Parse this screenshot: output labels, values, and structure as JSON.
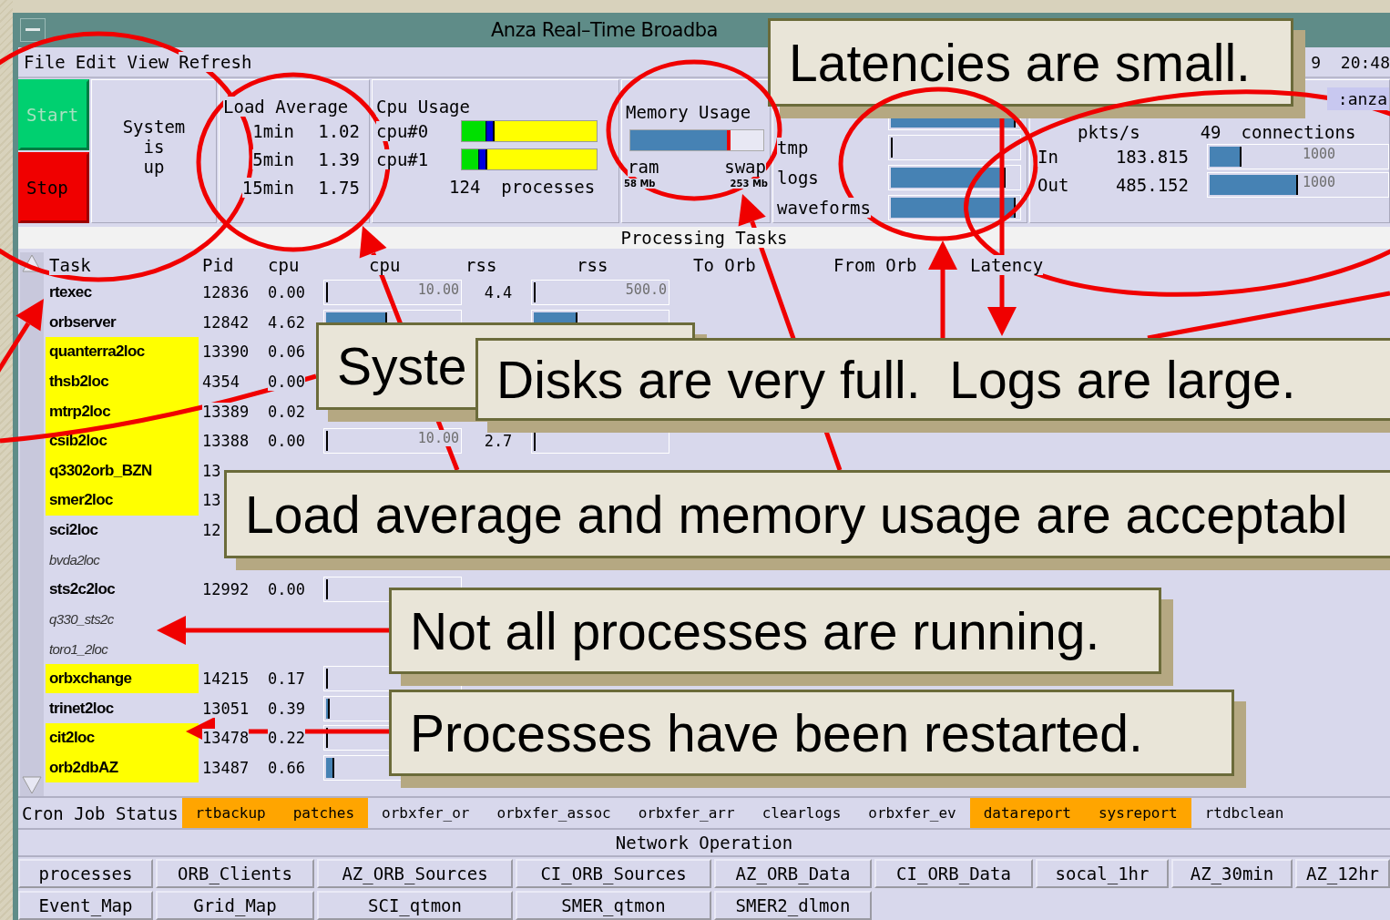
{
  "window": {
    "title": "Anza Real–Time Broadba",
    "clock": "9  20:48"
  },
  "menu": [
    "File",
    "Edit",
    "View",
    "Refresh"
  ],
  "controls": {
    "start": {
      "label": "Start",
      "disabled": true
    },
    "stop": {
      "label": "Stop",
      "disabled": false
    },
    "status": [
      "System",
      "is",
      "up"
    ]
  },
  "load_average": {
    "title": "Load Average",
    "rows": [
      {
        "label": "1min",
        "value": "1.02"
      },
      {
        "label": "5min",
        "value": "1.39"
      },
      {
        "label": "15min",
        "value": "1.75"
      }
    ]
  },
  "cpu_usage": {
    "title": "Cpu Usage",
    "cpus": [
      {
        "label": "cpu#0",
        "level": 0.24
      },
      {
        "label": "cpu#1",
        "level": 0.19
      }
    ],
    "processes": "124",
    "processes_label": "processes"
  },
  "memory": {
    "title": "Memory Usage",
    "level": 0.75,
    "ram_label": "ram",
    "swap_label": "swap",
    "ram_size": "58 Mb",
    "swap_size": "253 Mb"
  },
  "disks": [
    {
      "level": 0.98
    },
    {
      "label": "tmp",
      "level": 0
    },
    {
      "label": "logs",
      "level": 0.9
    },
    {
      "label": "waveforms",
      "level": 0.98
    }
  ],
  "network": {
    "host": ":anza",
    "pkts_label": "pkts/s",
    "connections": "49",
    "connections_label": "connections",
    "links": [
      {
        "label": "In",
        "rate": "183.815",
        "level": 0.18,
        "max": "1000"
      },
      {
        "label": "Out",
        "rate": "485.152",
        "level": 0.5,
        "max": "1000"
      }
    ]
  },
  "processing": {
    "title": "Processing Tasks",
    "columns": [
      "Task",
      "Pid",
      "cpu",
      "cpu",
      "rss",
      "rss",
      "To Orb",
      "From Orb",
      "Latency"
    ],
    "rows": [
      {
        "task": "rtexec",
        "pid": "12836",
        "cpu": "0.00",
        "running": true,
        "restarted": false,
        "cpu_bar": {
          "level": 0,
          "max": "10.00"
        },
        "rss": "4.4",
        "rss_bar": {
          "level": 0,
          "max": "500.0"
        }
      },
      {
        "task": "orbserver",
        "pid": "12842",
        "cpu": "4.62",
        "running": true,
        "restarted": false,
        "cpu_bar": {
          "level": 0.46
        },
        "rss_bar": {
          "level": 0.33
        }
      },
      {
        "task": "quanterra2loc",
        "pid": "13390",
        "cpu": "0.06",
        "running": true,
        "restarted": true
      },
      {
        "task": "thsb2loc",
        "pid": "4354",
        "cpu": "0.00",
        "running": true,
        "restarted": true
      },
      {
        "task": "mtrp2loc",
        "pid": "13389",
        "cpu": "0.02",
        "running": true,
        "restarted": true
      },
      {
        "task": "csib2loc",
        "pid": "13388",
        "cpu": "0.00",
        "running": true,
        "restarted": true,
        "cpu_bar": {
          "level": 0,
          "max": "10.00"
        },
        "rss": "2.7",
        "rss_bar": {
          "level": 0
        }
      },
      {
        "task": "q3302orb_BZN",
        "pid": "13",
        "running": true,
        "restarted": true
      },
      {
        "task": "smer2loc",
        "pid": "13",
        "running": true,
        "restarted": true
      },
      {
        "task": "sci2loc",
        "pid": "12",
        "running": true,
        "restarted": false
      },
      {
        "task": "bvda2loc",
        "running": false,
        "restarted": false
      },
      {
        "task": "sts2c2loc",
        "pid": "12992",
        "cpu": "0.00",
        "running": true,
        "restarted": false,
        "cpu_bar": {
          "level": 0.01
        }
      },
      {
        "task": "q330_sts2c",
        "running": false,
        "restarted": false
      },
      {
        "task": "toro1_2loc",
        "running": false,
        "restarted": false
      },
      {
        "task": "orbxchange",
        "pid": "14215",
        "cpu": "0.17",
        "running": true,
        "restarted": true,
        "cpu_bar": {
          "level": 0.01
        }
      },
      {
        "task": "trinet2loc",
        "pid": "13051",
        "cpu": "0.39",
        "running": true,
        "restarted": false,
        "cpu_bar": {
          "level": 0.03
        }
      },
      {
        "task": "cit2loc",
        "pid": "13478",
        "cpu": "0.22",
        "running": true,
        "restarted": true,
        "cpu_bar": {
          "level": 0.01
        }
      },
      {
        "task": "orb2dbAZ",
        "pid": "13487",
        "cpu": "0.66",
        "running": true,
        "restarted": true,
        "cpu_bar": {
          "level": 0.06
        }
      }
    ]
  },
  "cron": {
    "title": "Cron Job Status",
    "jobs": [
      {
        "name": "rtbackup",
        "flagged": true
      },
      {
        "name": "patches",
        "flagged": true
      },
      {
        "name": "orbxfer_or",
        "flagged": false
      },
      {
        "name": "orbxfer_assoc",
        "flagged": false
      },
      {
        "name": "orbxfer_arr",
        "flagged": false
      },
      {
        "name": "clearlogs",
        "flagged": false
      },
      {
        "name": "orbxfer_ev",
        "flagged": false
      },
      {
        "name": "datareport",
        "flagged": true
      },
      {
        "name": "sysreport",
        "flagged": true
      },
      {
        "name": "rtdbclean",
        "flagged": false
      }
    ]
  },
  "network_operation": {
    "title": "Network Operation",
    "buttons": [
      [
        "processes",
        "ORB_Clients",
        "AZ_ORB_Sources",
        "CI_ORB_Sources",
        "AZ_ORB_Data",
        "CI_ORB_Data",
        "socal_1hr",
        "AZ_30min",
        "AZ_12hr"
      ],
      [
        "Event_Map",
        "Grid_Map",
        "SCI_qtmon",
        "SMER_qtmon",
        "SMER2_dlmon"
      ]
    ]
  },
  "callouts": [
    {
      "text": "Latencies are small."
    },
    {
      "text": "Syste"
    },
    {
      "text": "Disks are very full.  Logs are large."
    },
    {
      "text": "Load average and memory usage are acceptabl"
    },
    {
      "text": "Not all processes are running."
    },
    {
      "text": "Processes have been restarted."
    }
  ]
}
